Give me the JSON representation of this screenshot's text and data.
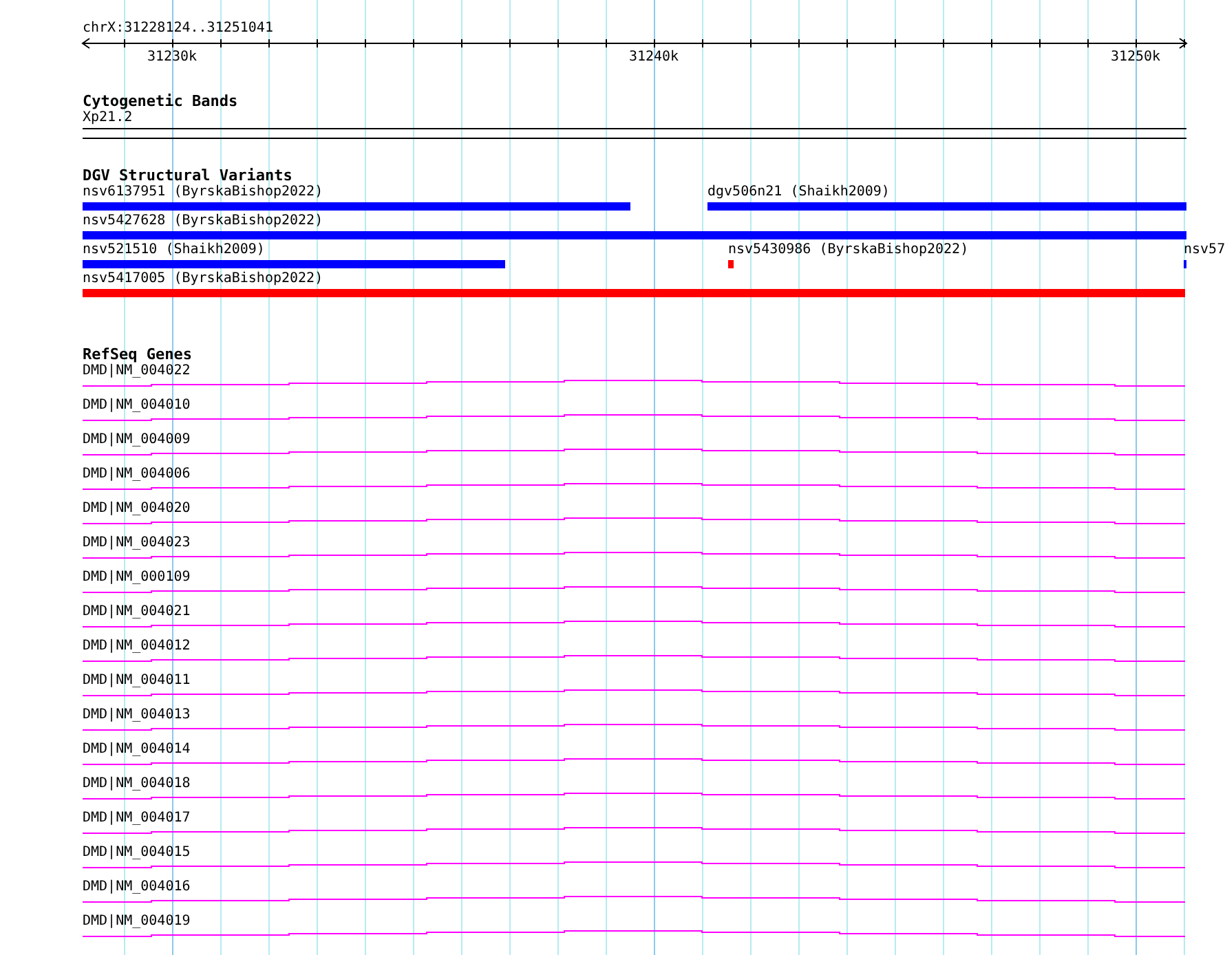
{
  "ruler": {
    "location": "chrX:31228124..31251041",
    "ticks": [
      "31230k",
      "31240k",
      "31250k"
    ]
  },
  "tracks": [
    {
      "kind": "bands",
      "title": "Cytogenetic Bands",
      "bands": [
        {
          "label": "Xp21.2"
        }
      ]
    },
    {
      "kind": "variants",
      "title": "DGV Structural Variants",
      "rows": [
        [
          {
            "label": "nsv6137951 (ByrskaBishop2022)",
            "color": "#0000ff"
          },
          {
            "label": "dgv506n21 (Shaikh2009)",
            "color": "#0000ff"
          }
        ],
        [
          {
            "label": "nsv5427628 (ByrskaBishop2022)",
            "color": "#0000ff"
          }
        ],
        [
          {
            "label": "nsv521510 (Shaikh2009)",
            "color": "#0000ff"
          },
          {
            "label": "nsv5430986 (ByrskaBishop2022)",
            "color": "#ff0000"
          },
          {
            "label": "nsv57",
            "color": "#0000ff"
          }
        ],
        [
          {
            "label": "nsv5417005 (ByrskaBishop2022)",
            "color": "#ff0000"
          }
        ]
      ]
    },
    {
      "kind": "genes",
      "title": "RefSeq Genes",
      "genes": [
        {
          "label": "DMD|NM_004022"
        },
        {
          "label": "DMD|NM_004010"
        },
        {
          "label": "DMD|NM_004009"
        },
        {
          "label": "DMD|NM_004006"
        },
        {
          "label": "DMD|NM_004020"
        },
        {
          "label": "DMD|NM_004023"
        },
        {
          "label": "DMD|NM_000109"
        },
        {
          "label": "DMD|NM_004021"
        },
        {
          "label": "DMD|NM_004012"
        },
        {
          "label": "DMD|NM_004011"
        },
        {
          "label": "DMD|NM_004013"
        },
        {
          "label": "DMD|NM_004014"
        },
        {
          "label": "DMD|NM_004018"
        },
        {
          "label": "DMD|NM_004017"
        },
        {
          "label": "DMD|NM_004015"
        },
        {
          "label": "DMD|NM_004016"
        },
        {
          "label": "DMD|NM_004019"
        }
      ]
    }
  ]
}
